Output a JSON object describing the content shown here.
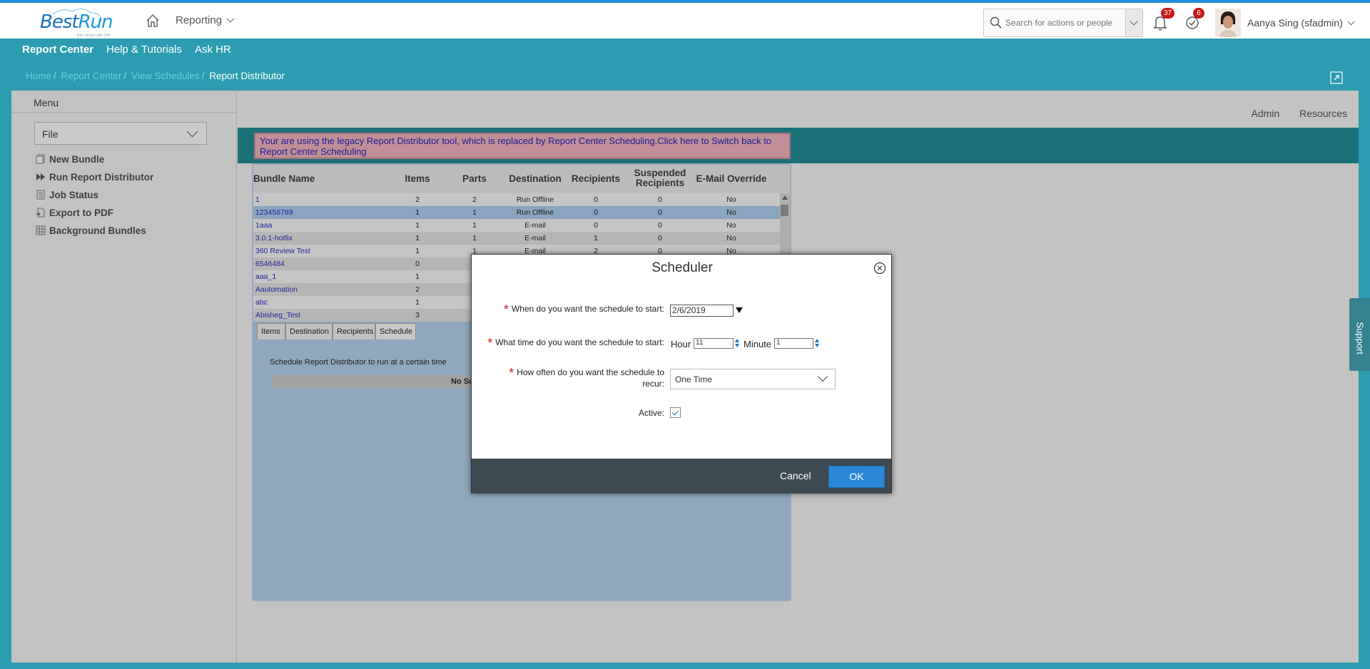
{
  "header": {
    "logo_text_a": "Best",
    "logo_text_b": "Run",
    "logo_tagline": "Run Simple with SAP",
    "nav_reporting": "Reporting",
    "search_placeholder": "Search for actions or people",
    "notifications_count": "37",
    "tasks_count": "6",
    "user_name": "Aanya Sing (sfadmin)"
  },
  "subnav": {
    "items": [
      "Report Center",
      "Help & Tutorials",
      "Ask HR"
    ]
  },
  "breadcrumb": {
    "items": [
      "Home",
      "Report Center",
      "View Schedules"
    ],
    "current": "Report Distributor"
  },
  "sidebar": {
    "title": "Menu",
    "file_select": "File",
    "items": [
      {
        "label": "New Bundle",
        "icon": "new-bundle-icon"
      },
      {
        "label": "Run Report Distributor",
        "icon": "run-icon"
      },
      {
        "label": "Job Status",
        "icon": "job-status-icon"
      },
      {
        "label": "Export to PDF",
        "icon": "pdf-icon"
      },
      {
        "label": "Background Bundles",
        "icon": "grid-icon"
      }
    ]
  },
  "toplinks": {
    "admin": "Admin",
    "resources": "Resources"
  },
  "legacy_banner": "Your are using the legacy Report Distributor tool, which is replaced by Report Center Scheduling.Click here to Switch back to Report Center Scheduling",
  "grid": {
    "headers": {
      "bundle_name": "Bundle Name",
      "items": "Items",
      "parts": "Parts",
      "destination": "Destination",
      "recipients": "Recipients",
      "suspended": "Suspended Recipients",
      "email_override": "E-Mail Override"
    },
    "rows": [
      {
        "name": "1",
        "items": "2",
        "parts": "2",
        "destination": "Run Offline",
        "recipients": "0",
        "suspended": "0",
        "override": "No"
      },
      {
        "name": "123456789",
        "items": "1",
        "parts": "1",
        "destination": "Run Offline",
        "recipients": "0",
        "suspended": "0",
        "override": "No"
      },
      {
        "name": "1aaa",
        "items": "1",
        "parts": "1",
        "destination": "E-mail",
        "recipients": "0",
        "suspended": "0",
        "override": "No"
      },
      {
        "name": "3.0.1-hotfix",
        "items": "1",
        "parts": "1",
        "destination": "E-mail",
        "recipients": "1",
        "suspended": "0",
        "override": "No"
      },
      {
        "name": "360 Review Test",
        "items": "1",
        "parts": "1",
        "destination": "E-mail",
        "recipients": "2",
        "suspended": "0",
        "override": "No"
      },
      {
        "name": "6546484",
        "items": "0",
        "parts": "",
        "destination": "",
        "recipients": "",
        "suspended": "",
        "override": ""
      },
      {
        "name": "aaa_1",
        "items": "1",
        "parts": "",
        "destination": "",
        "recipients": "",
        "suspended": "",
        "override": ""
      },
      {
        "name": "Aautomation",
        "items": "2",
        "parts": "",
        "destination": "",
        "recipients": "",
        "suspended": "",
        "override": ""
      },
      {
        "name": "abc",
        "items": "1",
        "parts": "",
        "destination": "",
        "recipients": "",
        "suspended": "",
        "override": ""
      },
      {
        "name": "Abisheg_Test",
        "items": "3",
        "parts": "",
        "destination": "",
        "recipients": "",
        "suspended": "",
        "override": ""
      }
    ],
    "selected_row": 1
  },
  "tabs": [
    "Items",
    "Destination",
    "Recipients",
    "Schedule"
  ],
  "active_tab": "Schedule",
  "schedule_tab": {
    "description": "Schedule Report Distributor to run at a certain time",
    "no_schedule": "No Sc"
  },
  "dialog": {
    "title": "Scheduler",
    "start_date_label": "When do you want the schedule to start:",
    "start_date_value": "2/6/2019",
    "start_time_label": "What time do you want the schedule to start:",
    "hour_label": "Hour",
    "hour_value": "11",
    "minute_label": "Minute",
    "minute_value": "1",
    "recur_label_line1": "How often do you want the schedule to",
    "recur_label_line2": "recur:",
    "recur_value": "One Time",
    "active_label": "Active:",
    "active_checked": true,
    "cancel_label": "Cancel",
    "ok_label": "OK"
  },
  "support_label": "Support",
  "colors": {
    "accent": "#2c9cb0",
    "primary_button": "#2b88d8",
    "dialog_footer": "#3e4a52",
    "required": "#d0201b"
  }
}
